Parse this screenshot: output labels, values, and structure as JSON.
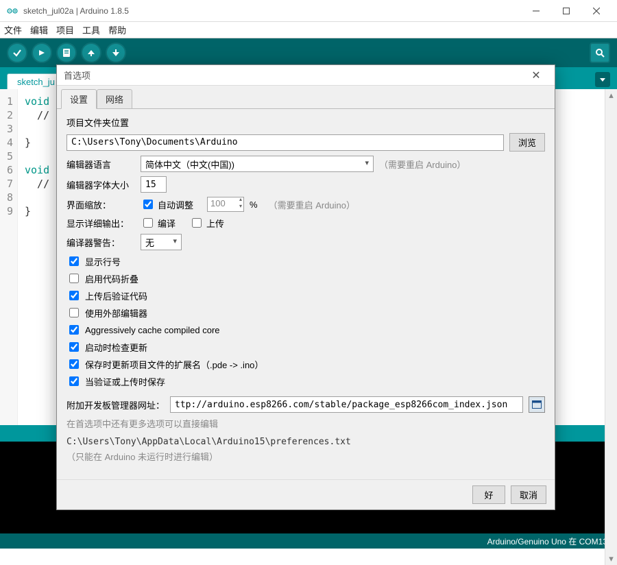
{
  "window": {
    "title": "sketch_jul02a | Arduino 1.8.5"
  },
  "menu": {
    "file": "文件",
    "edit": "编辑",
    "sketch": "项目",
    "tools": "工具",
    "help": "帮助"
  },
  "tabs": {
    "sketch": "sketch_ju"
  },
  "code": {
    "l1": "void s",
    "l2": "  // p",
    "l3": "",
    "l4": "}",
    "l5": "",
    "l6": "void l",
    "l7": "  // p",
    "l8": "",
    "l9": "}"
  },
  "footer": {
    "board": "Arduino/Genuino Uno 在 COM13"
  },
  "dlg": {
    "title": "首选项",
    "tab_settings": "设置",
    "tab_network": "网络",
    "sketchloc_label": "项目文件夹位置",
    "sketchloc_value": "C:\\Users\\Tony\\Documents\\Arduino",
    "browse": "浏览",
    "lang_label": "编辑器语言",
    "lang_value": "简体中文（中文(中国))",
    "restart_hint": "（需要重启 Arduino）",
    "fontsize_label": "编辑器字体大小",
    "fontsize_value": "15",
    "scale_label": "界面缩放：",
    "scale_auto": "自动调整",
    "scale_value": "100",
    "scale_pct": "%",
    "scale_hint": "（需要重启 Arduino）",
    "verbose_label": "显示详细输出：",
    "verbose_compile": "编译",
    "verbose_upload": "上传",
    "warn_label": "编译器警告：",
    "warn_value": "无",
    "chk_lineno": "显示行号",
    "chk_fold": "启用代码折叠",
    "chk_verify": "上传后验证代码",
    "chk_extern": "使用外部编辑器",
    "chk_cache": "Aggressively cache compiled core",
    "chk_update": "启动时检查更新",
    "chk_ext": "保存时更新项目文件的扩展名（.pde -> .ino）",
    "chk_save": "当验证或上传时保存",
    "boards_label": "附加开发板管理器网址：",
    "boards_value": "ttp://arduino.esp8266.com/stable/package_esp8266com_index.json",
    "more_hint": "在首选项中还有更多选项可以直接编辑",
    "prefs_path": "C:\\Users\\Tony\\AppData\\Local\\Arduino15\\preferences.txt",
    "prefs_hint": "（只能在 Arduino 未运行时进行编辑）",
    "ok": "好",
    "cancel": "取消"
  }
}
